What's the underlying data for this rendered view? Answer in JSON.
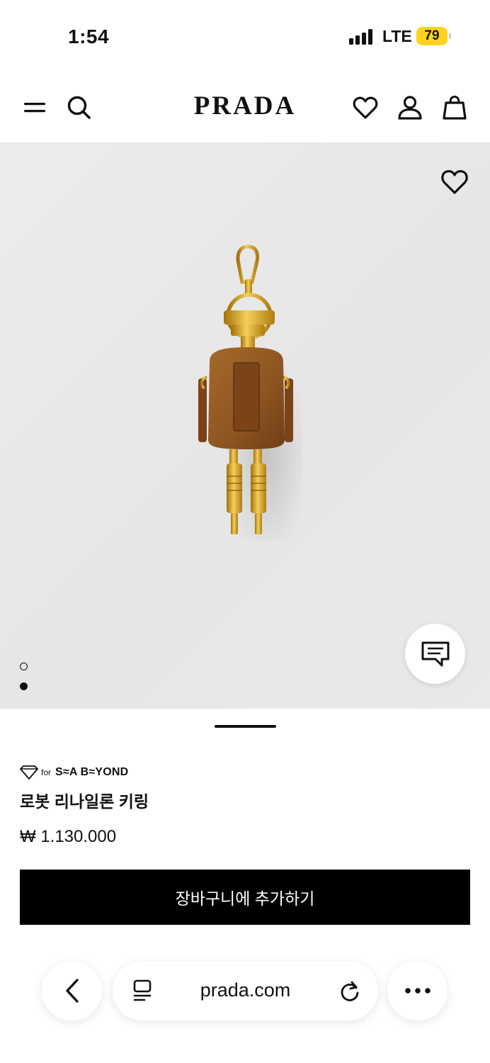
{
  "status_bar": {
    "time": "1:54",
    "network": "LTE",
    "battery": "79",
    "battery_color": "#ffd21f"
  },
  "header": {
    "logo": "PRADA",
    "icons": [
      "menu-icon",
      "search-icon",
      "heart-icon",
      "account-icon",
      "shopping-bag-icon"
    ]
  },
  "hero": {
    "background": "#e8e8e9",
    "carousel": {
      "total": 2,
      "active": 2
    },
    "icons": [
      "wishlist-heart-icon",
      "chat-icon"
    ]
  },
  "product": {
    "badge_for": "for",
    "badge_brand": "S≈A B≈YOND",
    "name": "로봇 리나일론 키링",
    "price": "₩ 1.130.000",
    "add_to_cart": "장바구니에 추가하기"
  },
  "browser": {
    "url": "prada.com",
    "icons": [
      "back-chevron-icon",
      "reader-icon",
      "reload-icon",
      "more-icon"
    ]
  }
}
